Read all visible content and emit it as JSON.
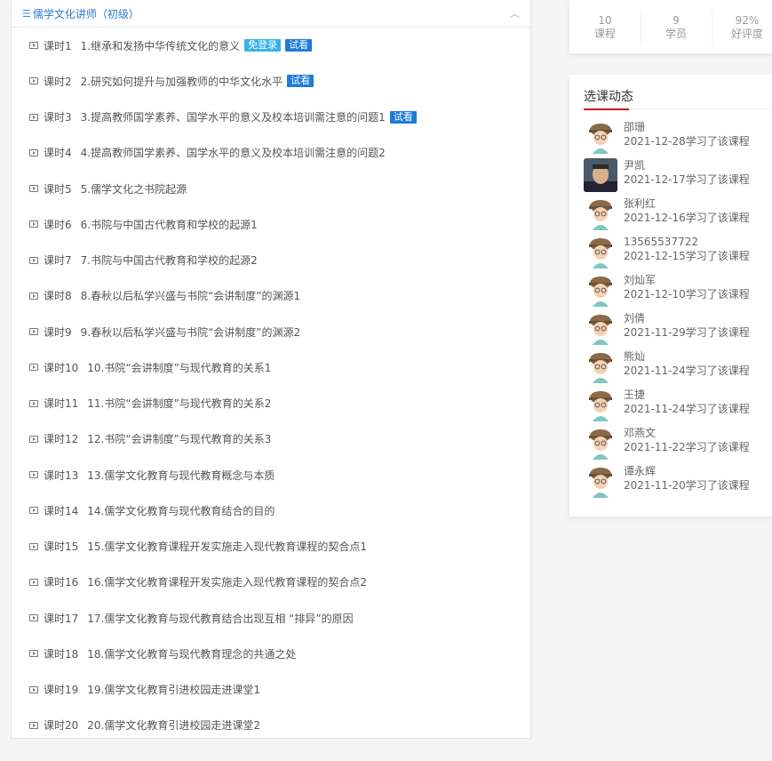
{
  "section": {
    "title": "儒学文化讲师（初级）"
  },
  "lessons": [
    {
      "num": "课时1",
      "title": "1.继承和发扬中华传统文化的意义",
      "badges": [
        "免登录",
        "试看"
      ]
    },
    {
      "num": "课时2",
      "title": "2.研究如何提升与加强教师的中华文化水平",
      "badges": [
        "试看"
      ]
    },
    {
      "num": "课时3",
      "title": "3.提高教师国学素养、国学水平的意义及校本培训需注意的问题1",
      "badges": [
        "试看"
      ]
    },
    {
      "num": "课时4",
      "title": "4.提高教师国学素养、国学水平的意义及校本培训需注意的问题2",
      "badges": []
    },
    {
      "num": "课时5",
      "title": "5.儒学文化之书院起源",
      "badges": []
    },
    {
      "num": "课时6",
      "title": "6.书院与中国古代教育和学校的起源1",
      "badges": []
    },
    {
      "num": "课时7",
      "title": "7.书院与中国古代教育和学校的起源2",
      "badges": []
    },
    {
      "num": "课时8",
      "title": "8.春秋以后私学兴盛与书院“会讲制度”的渊源1",
      "badges": []
    },
    {
      "num": "课时9",
      "title": "9.春秋以后私学兴盛与书院“会讲制度”的渊源2",
      "badges": []
    },
    {
      "num": "课时10",
      "title": "10.书院“会讲制度”与现代教育的关系1",
      "badges": []
    },
    {
      "num": "课时11",
      "title": "11.书院“会讲制度”与现代教育的关系2",
      "badges": []
    },
    {
      "num": "课时12",
      "title": "12.书院“会讲制度”与现代教育的关系3",
      "badges": []
    },
    {
      "num": "课时13",
      "title": "13.儒学文化教育与现代教育概念与本质",
      "badges": []
    },
    {
      "num": "课时14",
      "title": "14.儒学文化教育与现代教育结合的目的",
      "badges": []
    },
    {
      "num": "课时15",
      "title": "15.儒学文化教育课程开发实施走入现代教育课程的契合点1",
      "badges": []
    },
    {
      "num": "课时16",
      "title": "16.儒学文化教育课程开发实施走入现代教育课程的契合点2",
      "badges": []
    },
    {
      "num": "课时17",
      "title": "17.儒学文化教育与现代教育结合出现互相 “排异”的原因",
      "badges": []
    },
    {
      "num": "课时18",
      "title": "18.儒学文化教育与现代教育理念的共通之处",
      "badges": []
    },
    {
      "num": "课时19",
      "title": "19.儒学文化教育引进校园走进课堂1",
      "badges": []
    },
    {
      "num": "课时20",
      "title": "20.儒学文化教育引进校园走进课堂2",
      "badges": []
    }
  ],
  "stats": [
    {
      "value": "10",
      "label": "课程"
    },
    {
      "value": "9",
      "label": "学员"
    },
    {
      "value": "92%",
      "label": "好评度"
    }
  ],
  "activity": {
    "title": "选课动态",
    "items": [
      {
        "name": "邵珊",
        "time": "2021-12-28学习了该课程",
        "avatar": "cartoon-avatar-icon"
      },
      {
        "name": "尹凯",
        "time": "2021-12-17学习了该课程",
        "avatar": "photo-avatar"
      },
      {
        "name": "张利红",
        "time": "2021-12-16学习了该课程",
        "avatar": "cartoon-avatar-icon"
      },
      {
        "name": "13565537722",
        "time": "2021-12-15学习了该课程",
        "avatar": "cartoon-avatar-icon"
      },
      {
        "name": "刘灿军",
        "time": "2021-12-10学习了该课程",
        "avatar": "cartoon-avatar-icon"
      },
      {
        "name": "刘倩",
        "time": "2021-11-29学习了该课程",
        "avatar": "cartoon-avatar-icon"
      },
      {
        "name": "熊灿",
        "time": "2021-11-24学习了该课程",
        "avatar": "cartoon-avatar-icon"
      },
      {
        "name": "王捷",
        "time": "2021-11-24学习了该课程",
        "avatar": "cartoon-avatar-icon"
      },
      {
        "name": "邓燕文",
        "time": "2021-11-22学习了该课程",
        "avatar": "cartoon-avatar-icon"
      },
      {
        "name": "谭永辉",
        "time": "2021-11-20学习了该课程",
        "avatar": "cartoon-avatar-icon"
      }
    ]
  },
  "colors": {
    "link_blue": "#2b7ccc",
    "badge_free": "#36b3e6",
    "badge_trial": "#1f7ad8",
    "accent_red": "#d0121b"
  }
}
